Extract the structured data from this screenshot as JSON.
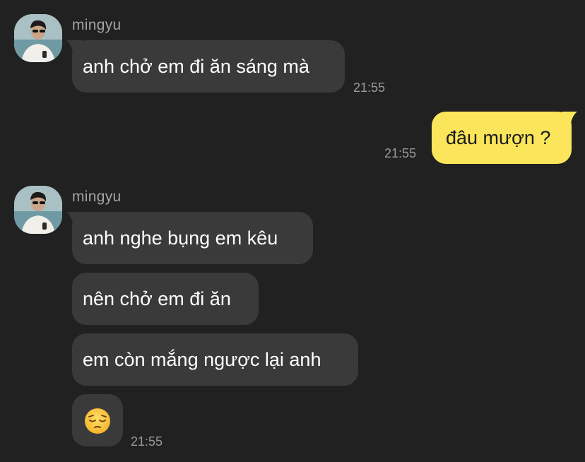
{
  "messages": [
    {
      "sender": "mingyu",
      "text": "anh chở em đi ăn sáng mà",
      "time": "21:55"
    },
    {
      "sender": "me",
      "text": "đâu mượn ?",
      "time": "21:55"
    },
    {
      "sender": "mingyu",
      "text": "anh nghe bụng em kêu"
    },
    {
      "sender": "mingyu",
      "text": "nên chở em đi ăn"
    },
    {
      "sender": "mingyu",
      "text": "em còn mắng ngược lại anh"
    },
    {
      "sender": "mingyu",
      "emoji": "pensive-face-emoji",
      "time": "21:55"
    }
  ],
  "colors": {
    "background": "#212121",
    "incoming_bubble": "#3a3a3b",
    "outgoing_bubble": "#fbe55b",
    "timestamp": "#9a9a9a",
    "sender_name": "#a3a3a3"
  }
}
